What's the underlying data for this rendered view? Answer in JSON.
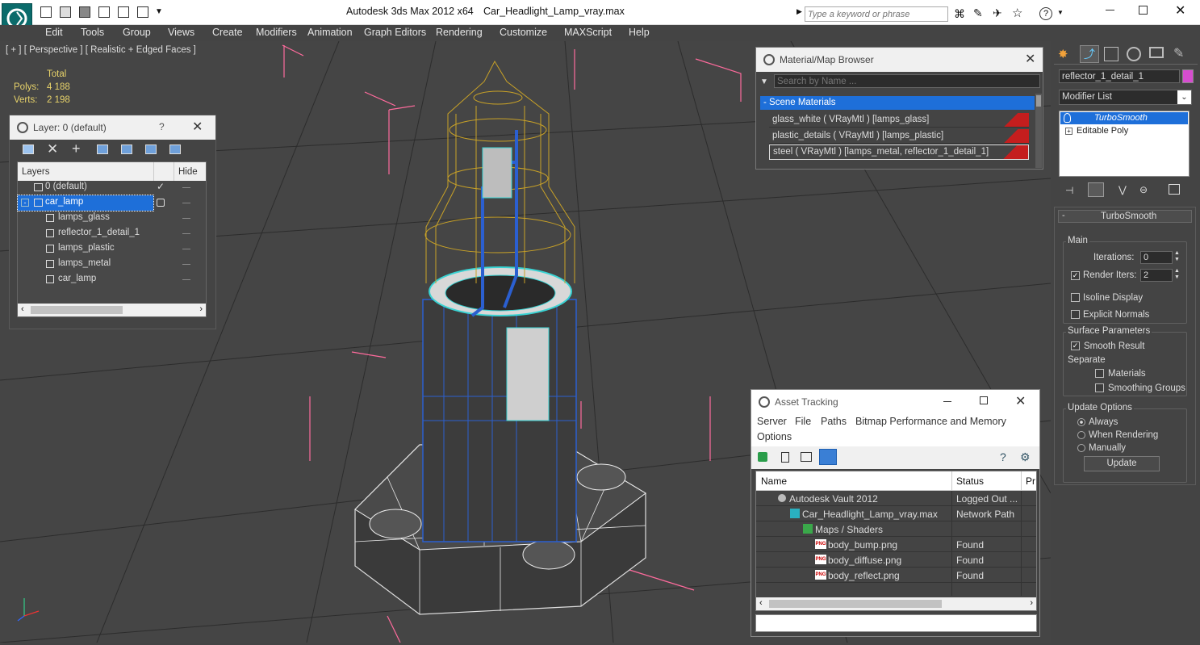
{
  "app": {
    "title": "Autodesk 3ds Max  2012 x64",
    "file": "Car_Headlight_Lamp_vray.max",
    "search_placeholder": "Type a keyword or phrase"
  },
  "menu": [
    "Edit",
    "Tools",
    "Group",
    "Views",
    "Create",
    "Modifiers",
    "Animation",
    "Graph Editors",
    "Rendering",
    "Customize",
    "MAXScript",
    "Help"
  ],
  "viewport": {
    "label": "[ + ] [ Perspective ] [ Realistic + Edged Faces ]",
    "stats_header": "Total",
    "polys_label": "Polys:",
    "polys_value": "4 188",
    "verts_label": "Verts:",
    "verts_value": "2 198"
  },
  "layer_panel": {
    "title": "Layer: 0 (default)",
    "help": "?",
    "col_layers": "Layers",
    "col_hide": "Hide",
    "rows": [
      "0 (default)",
      "car_lamp",
      "lamps_glass",
      "reflector_1_detail_1",
      "lamps_plastic",
      "lamps_metal",
      "car_lamp"
    ]
  },
  "material_browser": {
    "title": "Material/Map Browser",
    "search_placeholder": "Search by Name ...",
    "section": "- Scene Materials",
    "items": [
      "glass_white  ( VRayMtl ) [lamps_glass]",
      "plastic_details  ( VRayMtl ) [lamps_plastic]",
      "steel  ( VRayMtl ) [lamps_metal, reflector_1_detail_1]"
    ]
  },
  "asset_tracking": {
    "title": "Asset Tracking",
    "menu": [
      "Server",
      "File",
      "Paths",
      "Bitmap Performance and Memory",
      "Options"
    ],
    "columns": [
      "Name",
      "Status",
      "Pr"
    ],
    "rows": [
      {
        "name": "Autodesk Vault 2012",
        "status": "Logged Out ..."
      },
      {
        "name": "Car_Headlight_Lamp_vray.max",
        "status": "Network Path"
      },
      {
        "name": "Maps / Shaders",
        "status": ""
      },
      {
        "name": "body_bump.png",
        "status": "Found"
      },
      {
        "name": "body_diffuse.png",
        "status": "Found"
      },
      {
        "name": "body_reflect.png",
        "status": "Found"
      }
    ],
    "png_badge": "PNG"
  },
  "command_panel": {
    "object_name": "reflector_1_detail_1",
    "modifier_list": "Modifier List",
    "stack": [
      "TurboSmooth",
      "Editable Poly"
    ],
    "rollout_title": "TurboSmooth",
    "main_group": "Main",
    "iterations_label": "Iterations:",
    "iterations_value": "0",
    "render_iters_label": "Render Iters:",
    "render_iters_value": "2",
    "isoline": "Isoline Display",
    "explicit_normals": "Explicit Normals",
    "surface_group": "Surface Parameters",
    "smooth_result": "Smooth Result",
    "separate": "Separate",
    "materials": "Materials",
    "smoothing_groups": "Smoothing Groups",
    "update_group": "Update Options",
    "always": "Always",
    "when_rendering": "When Rendering",
    "manually": "Manually",
    "update_button": "Update"
  },
  "colors": {
    "selection_blue": "#1e6fd9",
    "wire_yellow": "#c9a227",
    "wire_cyan": "#39d3d3",
    "pink_bbox": "#ff6b9d",
    "material_red": "#c41e1e"
  }
}
